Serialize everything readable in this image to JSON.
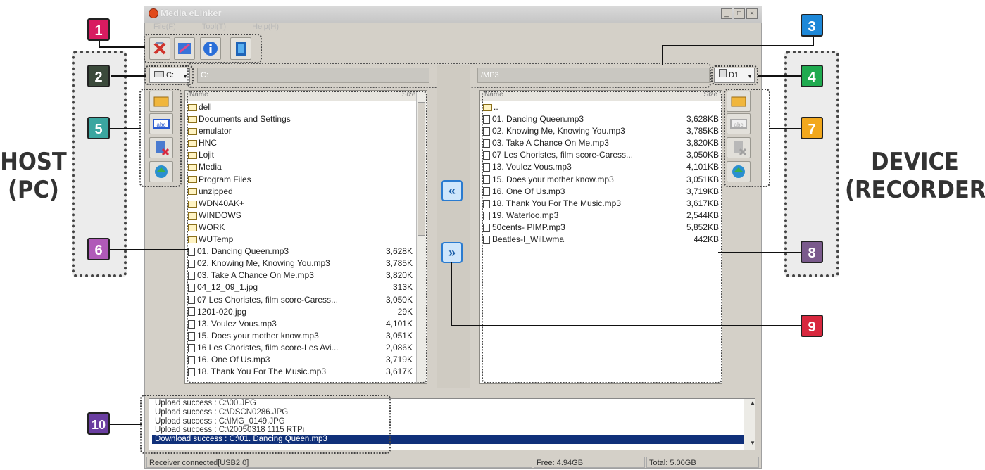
{
  "window": {
    "title": "Media eLinker",
    "menu": [
      "File(F)",
      "Tool(T)",
      "Help(H)"
    ]
  },
  "labels": {
    "host_line1": "HOST",
    "host_line2": "(PC)",
    "device_line1": "DEVICE",
    "device_line2": "(RECORDER)"
  },
  "host": {
    "drive": "C:",
    "path": "C:",
    "col_name": "Name",
    "col_size": "Size",
    "files": [
      {
        "name": "dell",
        "size": "",
        "type": "folder"
      },
      {
        "name": "Documents and Settings",
        "size": "",
        "type": "folder"
      },
      {
        "name": "emulator",
        "size": "",
        "type": "folder"
      },
      {
        "name": "HNC",
        "size": "",
        "type": "folder"
      },
      {
        "name": "Lojit",
        "size": "",
        "type": "folder"
      },
      {
        "name": "Media",
        "size": "",
        "type": "folder"
      },
      {
        "name": "Program Files",
        "size": "",
        "type": "folder"
      },
      {
        "name": "unzipped",
        "size": "",
        "type": "folder"
      },
      {
        "name": "WDN40AK+",
        "size": "",
        "type": "folder"
      },
      {
        "name": "WINDOWS",
        "size": "",
        "type": "folder"
      },
      {
        "name": "WORK",
        "size": "",
        "type": "folder"
      },
      {
        "name": "WUTemp",
        "size": "",
        "type": "folder"
      },
      {
        "name": "01. Dancing Queen.mp3",
        "size": "3,628K",
        "type": "file"
      },
      {
        "name": "02. Knowing Me, Knowing You.mp3",
        "size": "3,785K",
        "type": "file"
      },
      {
        "name": "03. Take A Chance On Me.mp3",
        "size": "3,820K",
        "type": "file"
      },
      {
        "name": "04_12_09_1.jpg",
        "size": "313K",
        "type": "file"
      },
      {
        "name": "07 Les Choristes, film score-Caress...",
        "size": "3,050K",
        "type": "file"
      },
      {
        "name": "1201-020.jpg",
        "size": "29K",
        "type": "file"
      },
      {
        "name": "13. Voulez Vous.mp3",
        "size": "4,101K",
        "type": "file"
      },
      {
        "name": "15. Does your mother know.mp3",
        "size": "3,051K",
        "type": "file"
      },
      {
        "name": "16 Les Choristes, film score-Les Avi...",
        "size": "2,086K",
        "type": "file"
      },
      {
        "name": "16. One Of Us.mp3",
        "size": "3,719K",
        "type": "file"
      },
      {
        "name": "18. Thank You For The Music.mp3",
        "size": "3,617K",
        "type": "file"
      }
    ]
  },
  "device": {
    "drive": "D1",
    "path": "/MP3",
    "col_name": "Name",
    "col_size": "Size",
    "files": [
      {
        "name": "..",
        "size": "",
        "type": "folder"
      },
      {
        "name": "01. Dancing Queen.mp3",
        "size": "3,628KB",
        "type": "file"
      },
      {
        "name": "02. Knowing Me, Knowing You.mp3",
        "size": "3,785KB",
        "type": "file"
      },
      {
        "name": "03. Take A Chance On Me.mp3",
        "size": "3,820KB",
        "type": "file"
      },
      {
        "name": "07 Les Choristes, film score-Caress...",
        "size": "3,050KB",
        "type": "file"
      },
      {
        "name": "13. Voulez Vous.mp3",
        "size": "4,101KB",
        "type": "file"
      },
      {
        "name": "15. Does your mother know.mp3",
        "size": "3,051KB",
        "type": "file"
      },
      {
        "name": "16. One Of Us.mp3",
        "size": "3,719KB",
        "type": "file"
      },
      {
        "name": "18. Thank You For The Music.mp3",
        "size": "3,617KB",
        "type": "file"
      },
      {
        "name": "19. Waterloo.mp3",
        "size": "2,544KB",
        "type": "file"
      },
      {
        "name": "50cents- PIMP.mp3",
        "size": "5,852KB",
        "type": "file"
      },
      {
        "name": "Beatles-I_Will.wma",
        "size": "442KB",
        "type": "file"
      }
    ]
  },
  "transfer": {
    "to_host": "«",
    "to_device": "»"
  },
  "log": [
    "Upload success : C:\\00.JPG",
    "Upload success : C:\\DSCN0286.JPG",
    "Upload success : C:\\IMG_0149.JPG",
    "Upload success : C:\\20050318 1115 RTPi",
    "Download success : C:\\01. Dancing Queen.mp3"
  ],
  "status": {
    "connection": "Receiver connected[USB2.0]",
    "free": "Free: 4.94GB",
    "total": "Total: 5.00GB"
  },
  "callouts": [
    {
      "n": "1",
      "color": "#d81b60"
    },
    {
      "n": "2",
      "color": "#3b4a3b"
    },
    {
      "n": "3",
      "color": "#1e88d8"
    },
    {
      "n": "4",
      "color": "#1faa4f"
    },
    {
      "n": "5",
      "color": "#3aa6a0"
    },
    {
      "n": "6",
      "color": "#b05ab8"
    },
    {
      "n": "7",
      "color": "#f2a81d"
    },
    {
      "n": "8",
      "color": "#7a5a8c"
    },
    {
      "n": "9",
      "color": "#d8283e"
    },
    {
      "n": "10",
      "color": "#6a3ea1"
    }
  ],
  "icons": {
    "toolbar": [
      "disconnect-icon",
      "properties-icon",
      "info-icon",
      "exit-icon"
    ],
    "host_side": [
      "new-folder-icon",
      "rename-icon",
      "delete-icon",
      "refresh-icon"
    ],
    "device_side": [
      "new-folder-icon",
      "rename-icon",
      "delete-icon",
      "refresh-icon"
    ]
  }
}
